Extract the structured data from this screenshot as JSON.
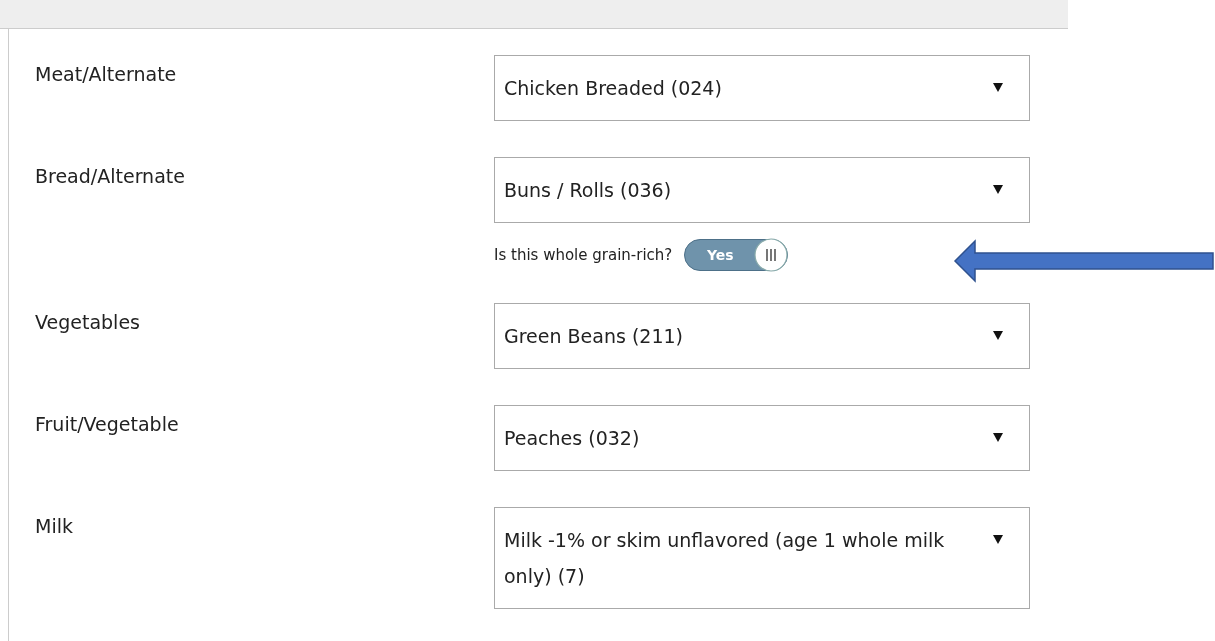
{
  "fields": [
    {
      "label": "Meat/Alternate",
      "value": "Chicken Breaded (024)"
    },
    {
      "label": "Bread/Alternate",
      "value": "Buns / Rolls (036)",
      "toggle": {
        "question": "Is this whole grain-rich?",
        "on": true,
        "on_label": "Yes"
      }
    },
    {
      "label": "Vegetables",
      "value": "Green Beans (211)"
    },
    {
      "label": "Fruit/Vegetable",
      "value": "Peaches (032)"
    },
    {
      "label": "Milk",
      "value": "Milk -1% or skim unflavored (age 1 whole milk only) (7)"
    }
  ]
}
